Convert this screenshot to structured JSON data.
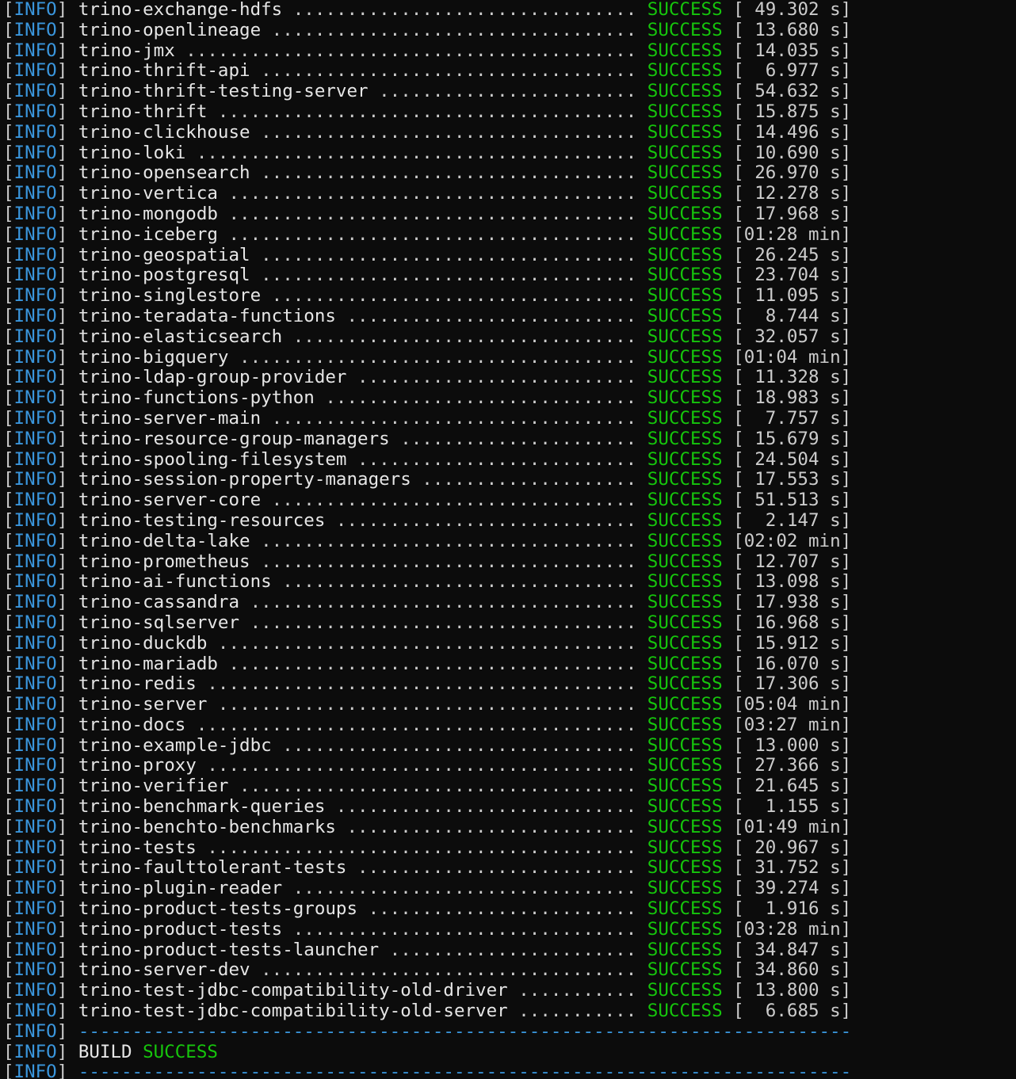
{
  "colors": {
    "background": "#0c0c0c",
    "text": "#cccccc",
    "info": "#3a96dd",
    "success": "#16c60c"
  },
  "level": "INFO",
  "status": "SUCCESS",
  "rows": [
    {
      "module": "trino-exchange-hdfs",
      "time": " 49.302 s"
    },
    {
      "module": "trino-openlineage",
      "time": " 13.680 s"
    },
    {
      "module": "trino-jmx",
      "time": " 14.035 s"
    },
    {
      "module": "trino-thrift-api",
      "time": "  6.977 s"
    },
    {
      "module": "trino-thrift-testing-server",
      "time": " 54.632 s"
    },
    {
      "module": "trino-thrift",
      "time": " 15.875 s"
    },
    {
      "module": "trino-clickhouse",
      "time": " 14.496 s"
    },
    {
      "module": "trino-loki",
      "time": " 10.690 s"
    },
    {
      "module": "trino-opensearch",
      "time": " 26.970 s"
    },
    {
      "module": "trino-vertica",
      "time": " 12.278 s"
    },
    {
      "module": "trino-mongodb",
      "time": " 17.968 s"
    },
    {
      "module": "trino-iceberg",
      "time": "01:28 min"
    },
    {
      "module": "trino-geospatial",
      "time": " 26.245 s"
    },
    {
      "module": "trino-postgresql",
      "time": " 23.704 s"
    },
    {
      "module": "trino-singlestore",
      "time": " 11.095 s"
    },
    {
      "module": "trino-teradata-functions",
      "time": "  8.744 s"
    },
    {
      "module": "trino-elasticsearch",
      "time": " 32.057 s"
    },
    {
      "module": "trino-bigquery",
      "time": "01:04 min"
    },
    {
      "module": "trino-ldap-group-provider",
      "time": " 11.328 s"
    },
    {
      "module": "trino-functions-python",
      "time": " 18.983 s"
    },
    {
      "module": "trino-server-main",
      "time": "  7.757 s"
    },
    {
      "module": "trino-resource-group-managers",
      "time": " 15.679 s"
    },
    {
      "module": "trino-spooling-filesystem",
      "time": " 24.504 s"
    },
    {
      "module": "trino-session-property-managers",
      "time": " 17.553 s"
    },
    {
      "module": "trino-server-core",
      "time": " 51.513 s"
    },
    {
      "module": "trino-testing-resources",
      "time": "  2.147 s"
    },
    {
      "module": "trino-delta-lake",
      "time": "02:02 min"
    },
    {
      "module": "trino-prometheus",
      "time": " 12.707 s"
    },
    {
      "module": "trino-ai-functions",
      "time": " 13.098 s"
    },
    {
      "module": "trino-cassandra",
      "time": " 17.938 s"
    },
    {
      "module": "trino-sqlserver",
      "time": " 16.968 s"
    },
    {
      "module": "trino-duckdb",
      "time": " 15.912 s"
    },
    {
      "module": "trino-mariadb",
      "time": " 16.070 s"
    },
    {
      "module": "trino-redis",
      "time": " 17.306 s"
    },
    {
      "module": "trino-server",
      "time": "05:04 min"
    },
    {
      "module": "trino-docs",
      "time": "03:27 min"
    },
    {
      "module": "trino-example-jdbc",
      "time": " 13.000 s"
    },
    {
      "module": "trino-proxy",
      "time": " 27.366 s"
    },
    {
      "module": "trino-verifier",
      "time": " 21.645 s"
    },
    {
      "module": "trino-benchmark-queries",
      "time": "  1.155 s"
    },
    {
      "module": "trino-benchto-benchmarks",
      "time": "01:49 min"
    },
    {
      "module": "trino-tests",
      "time": " 20.967 s"
    },
    {
      "module": "trino-faulttolerant-tests",
      "time": " 31.752 s"
    },
    {
      "module": "trino-plugin-reader",
      "time": " 39.274 s"
    },
    {
      "module": "trino-product-tests-groups",
      "time": "  1.916 s"
    },
    {
      "module": "trino-product-tests",
      "time": "03:28 min"
    },
    {
      "module": "trino-product-tests-launcher",
      "time": " 34.847 s"
    },
    {
      "module": "trino-server-dev",
      "time": " 34.860 s"
    },
    {
      "module": "trino-test-jdbc-compatibility-old-driver",
      "time": " 13.800 s"
    },
    {
      "module": "trino-test-jdbc-compatibility-old-server",
      "time": "  6.685 s"
    }
  ],
  "separator": "------------------------------------------------------------------------",
  "build": {
    "label": "BUILD",
    "status": "SUCCESS"
  }
}
